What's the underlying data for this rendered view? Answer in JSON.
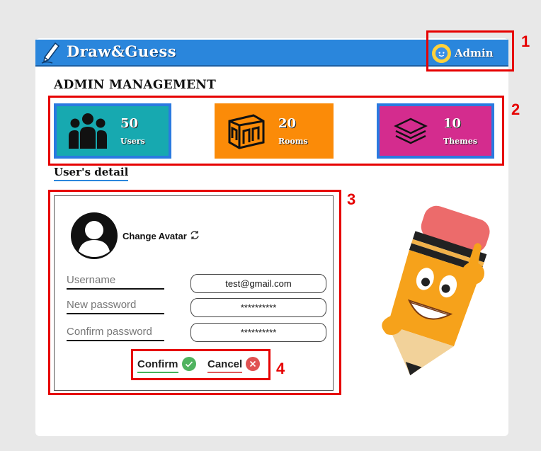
{
  "app": {
    "title": "Draw&Guess"
  },
  "header": {
    "user_label": "Admin"
  },
  "page": {
    "heading": "ADMIN MANAGEMENT"
  },
  "stats": [
    {
      "value": "50",
      "label": "Users",
      "color": "#17a9b0"
    },
    {
      "value": "20",
      "label": "Rooms",
      "color": "#fb8b08"
    },
    {
      "value": "10",
      "label": "Themes",
      "color": "#d42c8e"
    }
  ],
  "detail": {
    "section_title": "User's detail",
    "change_avatar_label": "Change Avatar",
    "fields": [
      {
        "label": "Username",
        "value": "test@gmail.com"
      },
      {
        "label": "New password",
        "value": "**********"
      },
      {
        "label": "Confirm password",
        "value": "**********"
      }
    ],
    "confirm_label": "Confirm",
    "cancel_label": "Cancel"
  },
  "annotations": [
    "1",
    "2",
    "3",
    "4"
  ]
}
